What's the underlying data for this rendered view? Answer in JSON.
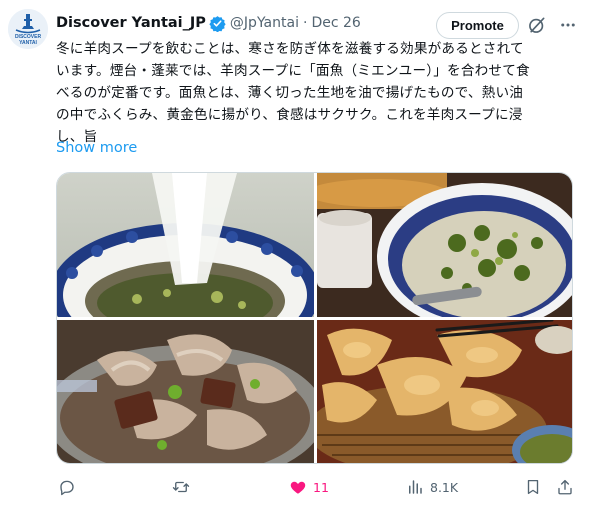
{
  "account": {
    "display_name": "Discover Yantai_JP",
    "handle": "@JpYantai",
    "separator": "·",
    "date": "Dec 26",
    "avatar_logo_text": [
      "DISCOVER",
      "YANTAI"
    ],
    "verified": true
  },
  "header": {
    "promote_label": "Promote"
  },
  "tweet": {
    "text_lines": [
      "冬に羊肉スープを飲むことは、寒さを防ぎ体を滋養する効果があるとされて",
      "います。煙台・蓬莱では、羊肉スープに「面魚（ミエンユー）」を合わせて食",
      "べるのが定番です。面魚とは、薄く切った生地を油で揚げたもので、熱い油",
      "の中でふくらみ、黄金色に揚がり、食感はサクサク。これを羊肉スープに浸",
      "し、旨"
    ],
    "show_more": "Show more"
  },
  "media": {
    "images": [
      {
        "subject": "mutton soup being poured into a blue-and-white bowl"
      },
      {
        "subject": "bowl of mutton soup with herbs next to fried dough"
      },
      {
        "subject": "close-up of sliced mutton and offal in soup"
      },
      {
        "subject": "golden fried mianyu dough in a wicker basket"
      }
    ]
  },
  "actions": {
    "reply_count": "",
    "repost_count": "",
    "like_count": "11",
    "views_count": "8.1K",
    "icons": [
      "reply-icon",
      "repost-icon",
      "like-icon",
      "views-icon",
      "bookmark-icon",
      "share-icon"
    ]
  },
  "colors": {
    "link_blue": "#1d9bf0",
    "like_pink": "#f91880",
    "muted_gray": "#536471",
    "verified_blue": "#1d9bf0"
  }
}
